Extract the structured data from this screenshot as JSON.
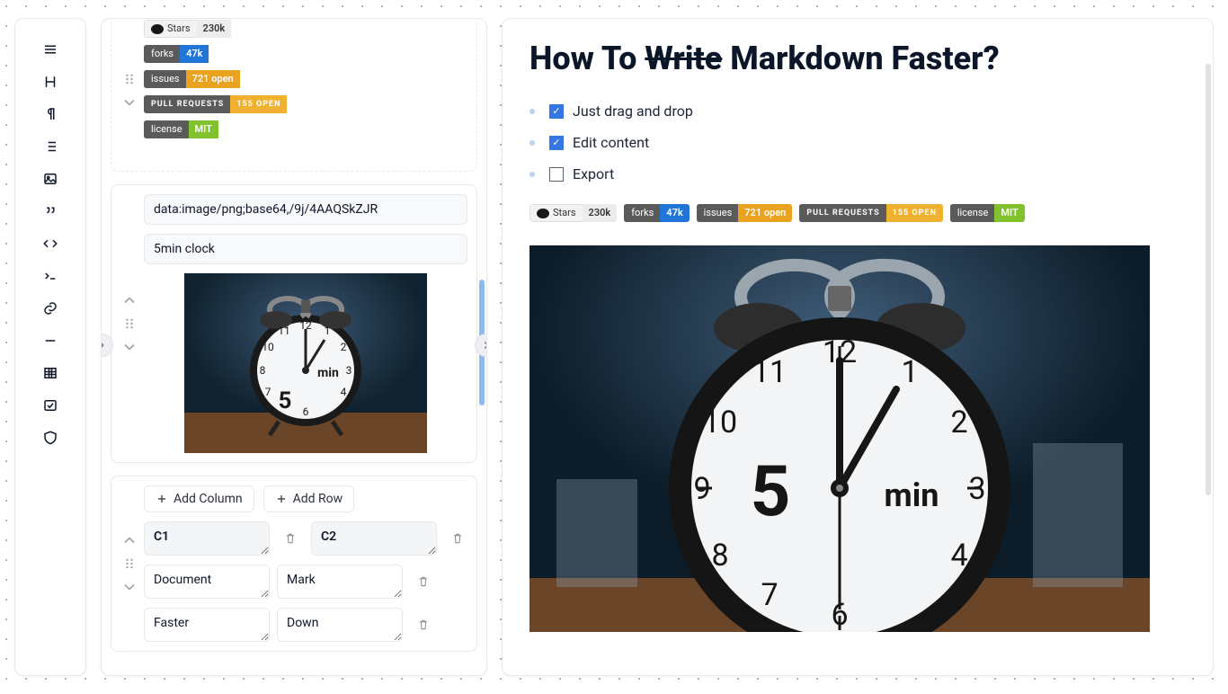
{
  "title": {
    "pre": "How To ",
    "strike": "Write",
    "post": " Markdown Faster?"
  },
  "checklist": [
    {
      "checked": true,
      "label": "Just drag and drop"
    },
    {
      "checked": true,
      "label": "Edit content"
    },
    {
      "checked": false,
      "label": "Export"
    }
  ],
  "badges": [
    {
      "leftDark": false,
      "hasGh": true,
      "leftText": "Stars",
      "rightText": "230k",
      "rightBg": "#ececec",
      "rightColor": "#333"
    },
    {
      "leftDark": true,
      "leftText": "forks",
      "rightText": "47k",
      "rightBg": "#2075d6"
    },
    {
      "leftDark": true,
      "leftText": "issues",
      "rightText": "721 open",
      "rightBg": "#e9a321"
    },
    {
      "leftDark": true,
      "leftText": "PULL REQUESTS",
      "rightText": "155 OPEN",
      "rightBg": "#efb12f",
      "ls": true
    },
    {
      "leftDark": true,
      "leftText": "license",
      "rightText": "MIT",
      "rightBg": "#82c22f"
    }
  ],
  "editor": {
    "image_url": "data:image/png;base64,/9j/4AAQSkZJR",
    "image_alt": "5min clock",
    "addColumn": "Add Column",
    "addRow": "Add Row",
    "table": {
      "headers": [
        "C1",
        "C2"
      ],
      "rows": [
        [
          "Document",
          "Mark"
        ],
        [
          "Faster",
          "Down"
        ]
      ]
    }
  }
}
